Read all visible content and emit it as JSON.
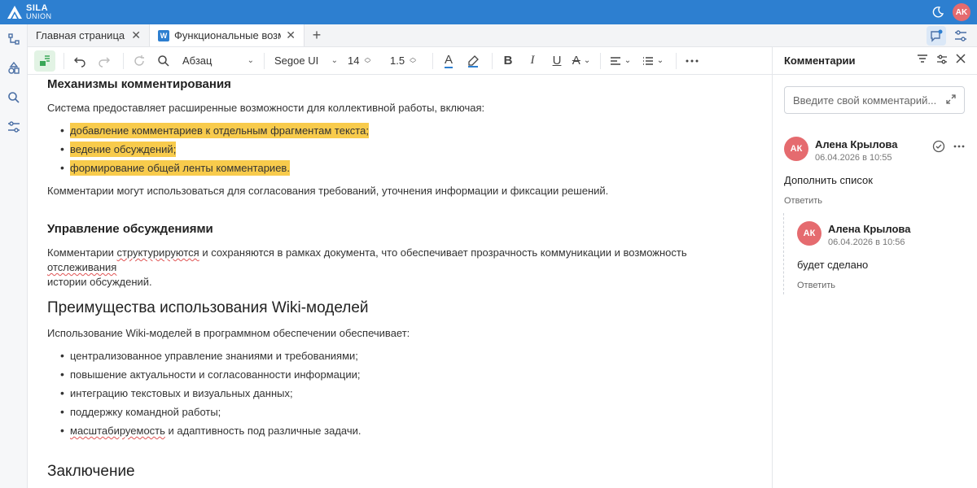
{
  "app": {
    "logo_line1": "SILA",
    "logo_line2": "UNION",
    "user_initials": "AK"
  },
  "colors": {
    "header_blue": "#2d7fd0",
    "highlight": "#f8cb4c",
    "avatar": "#e56b6f",
    "active_tool_bg": "#e2f3e4"
  },
  "tabs": [
    {
      "label": "Главная страница"
    },
    {
      "label": "Функциональные возм",
      "badge": "W"
    }
  ],
  "toolbar": {
    "paragraph_style": "Абзац",
    "font_family": "Segoe UI",
    "font_size": "14",
    "line_spacing": "1.5",
    "bold": "B",
    "italic": "I",
    "underline": "U",
    "color_a": "A",
    "highlight_a": "A"
  },
  "document": {
    "heading1": "Механизмы комментирования",
    "para1": "Система предоставляет расширенные возможности для коллективной работы, включая:",
    "list1": [
      "добавление комментариев к отдельным фрагментам текста;",
      "ведение обсуждений;",
      "формирование общей ленты комментариев."
    ],
    "para2": "Комментарии могут использоваться для согласования требований, уточнения информации и фиксации решений.",
    "heading2": "Управление обсуждениями",
    "para3_a": "Комментарии ",
    "para3_b": "структурируются",
    "para3_c": " и сохраняются в рамках документа, что обеспечивает прозрачность коммуникации и возможность ",
    "para3_d": "отслеживания",
    "para3_e": "истории обсуждений.",
    "heading3": "Преимущества использования Wiki-моделей",
    "para4": "Использование Wiki-моделей в программном обеспечении обеспечивает:",
    "list2": [
      "централизованное управление знаниями и требованиями;",
      "повышение актуальности и согласованности информации;",
      "интеграцию текстовых и визуальных данных;",
      "поддержку командной работы;"
    ],
    "list2_last_a": "масштабируемость",
    "list2_last_b": " и адаптивность под различные задачи.",
    "heading4": "Заключение"
  },
  "comments_panel": {
    "title": "Комментарии",
    "input_placeholder": "Введите свой комментарий...",
    "comments": [
      {
        "initials": "АК",
        "author": "Алена Крылова",
        "time": "06.04.2026 в 10:55",
        "text": "Дополнить список",
        "reply": "Ответить"
      },
      {
        "initials": "АК",
        "author": "Алена Крылова",
        "time": "06.04.2026 в 10:56",
        "text": "будет сделано",
        "reply": "Ответить"
      }
    ]
  }
}
